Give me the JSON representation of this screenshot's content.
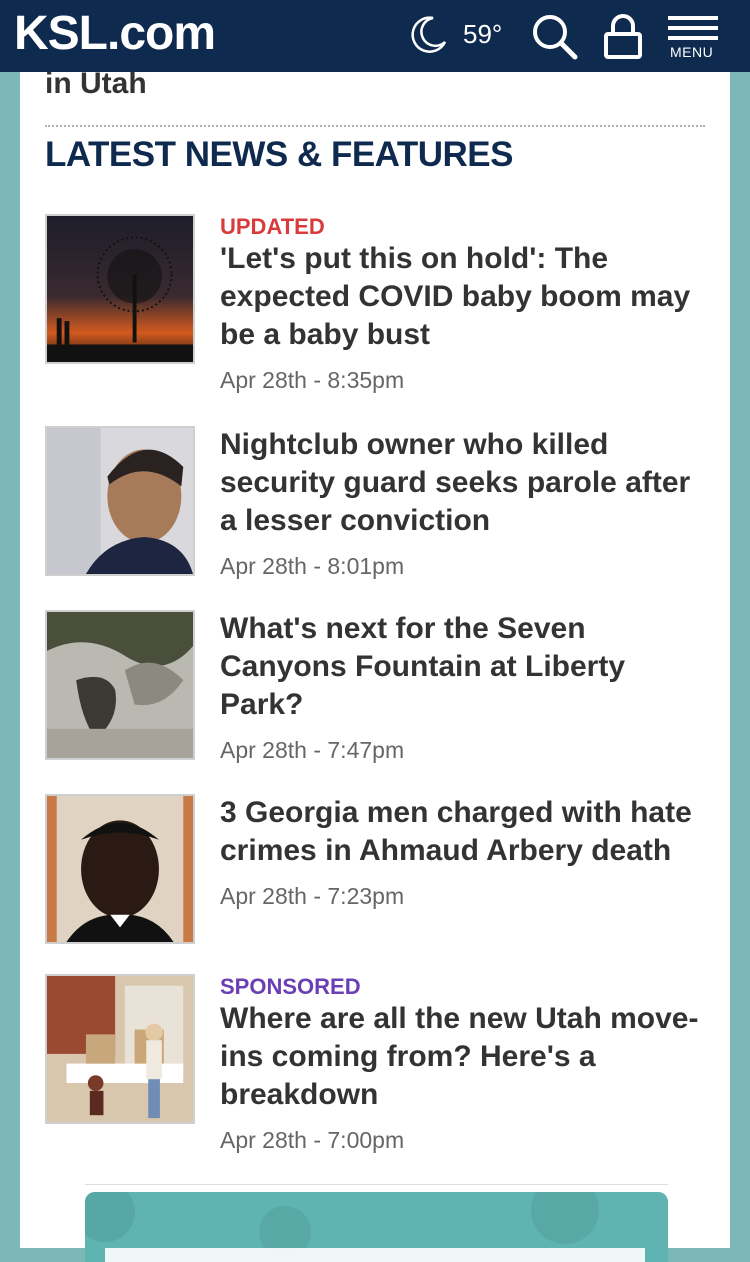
{
  "header": {
    "logo": "KSL.com",
    "temperature": "59°",
    "menu_label": "MENU"
  },
  "breadcrumb": "in Utah",
  "section_title": "LATEST NEWS & FEATURES",
  "articles": [
    {
      "tag": "UPDATED",
      "headline": "'Let's put this on hold': The expected COVID baby boom may be a baby bust",
      "date": "Apr 28th - 8:35pm"
    },
    {
      "tag": "",
      "headline": "Nightclub owner who killed security guard seeks parole after a lesser conviction",
      "date": "Apr 28th - 8:01pm"
    },
    {
      "tag": "",
      "headline": "What's next for the Seven Canyons Fountain at Liberty Park?",
      "date": "Apr 28th - 7:47pm"
    },
    {
      "tag": "",
      "headline": "3 Georgia men charged with hate crimes in Ahmaud Arbery death",
      "date": "Apr 28th - 7:23pm"
    },
    {
      "tag": "SPONSORED",
      "headline": "Where are all the new Utah move-ins coming from? Here's a breakdown",
      "date": "Apr 28th - 7:00pm"
    }
  ],
  "colors": {
    "header_bg": "#0f2a4f",
    "page_bg": "#7db8b9",
    "updated": "#d93b3b",
    "sponsored": "#6a3fb5"
  },
  "icons": [
    "moon-icon",
    "search-icon",
    "user-icon",
    "menu-icon"
  ]
}
